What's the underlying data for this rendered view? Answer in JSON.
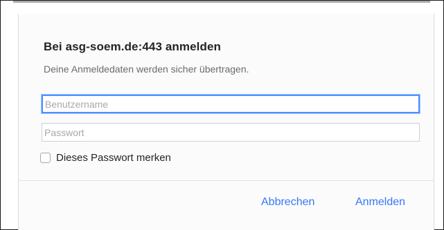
{
  "dialog": {
    "title": "Bei asg-soem.de:443 anmelden",
    "subtitle": "Deine Anmeldedaten werden sicher übertragen.",
    "username": {
      "value": "",
      "placeholder": "Benutzername"
    },
    "password": {
      "value": "",
      "placeholder": "Passwort"
    },
    "remember": {
      "label": "Dieses Passwort merken",
      "checked": false
    },
    "buttons": {
      "cancel": "Abbrechen",
      "login": "Anmelden"
    }
  },
  "colors": {
    "accent": "#3478f6",
    "focus_ring": "#4d90fe",
    "dialog_background": "#fbfbfb"
  }
}
